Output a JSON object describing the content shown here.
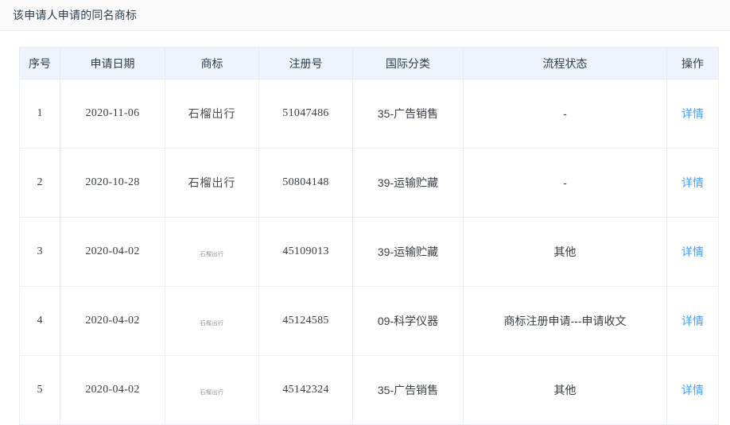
{
  "header": {
    "title": "该申请人申请的同名商标"
  },
  "table": {
    "columns": [
      {
        "key": "index",
        "label": "序号"
      },
      {
        "key": "date",
        "label": "申请日期"
      },
      {
        "key": "mark",
        "label": "商标"
      },
      {
        "key": "regno",
        "label": "注册号"
      },
      {
        "key": "class",
        "label": "国际分类"
      },
      {
        "key": "status",
        "label": "流程状态"
      },
      {
        "key": "action",
        "label": "操作"
      }
    ],
    "action_label": "详情",
    "rows": [
      {
        "index": "1",
        "date": "2020-11-06",
        "mark": "石榴出行",
        "mark_style": "text",
        "regno": "51047486",
        "class": "35-广告销售",
        "status": "-",
        "action": "详情"
      },
      {
        "index": "2",
        "date": "2020-10-28",
        "mark": "石榴出行",
        "mark_style": "text",
        "regno": "50804148",
        "class": "39-运输贮藏",
        "status": "-",
        "action": "详情"
      },
      {
        "index": "3",
        "date": "2020-04-02",
        "mark": "石榴出行",
        "mark_style": "image",
        "regno": "45109013",
        "class": "39-运输贮藏",
        "status": "其他",
        "action": "详情"
      },
      {
        "index": "4",
        "date": "2020-04-02",
        "mark": "石榴出行",
        "mark_style": "image",
        "regno": "45124585",
        "class": "09-科学仪器",
        "status": "商标注册申请---申请收文",
        "action": "详情"
      },
      {
        "index": "5",
        "date": "2020-04-02",
        "mark": "石榴出行",
        "mark_style": "image",
        "regno": "45142324",
        "class": "35-广告销售",
        "status": "其他",
        "action": "详情"
      }
    ]
  },
  "colors": {
    "header_bg": "#fafafa",
    "table_head_bg": "#eef4fb",
    "border": "#ebeef5",
    "link": "#409eff",
    "text": "#303133"
  }
}
